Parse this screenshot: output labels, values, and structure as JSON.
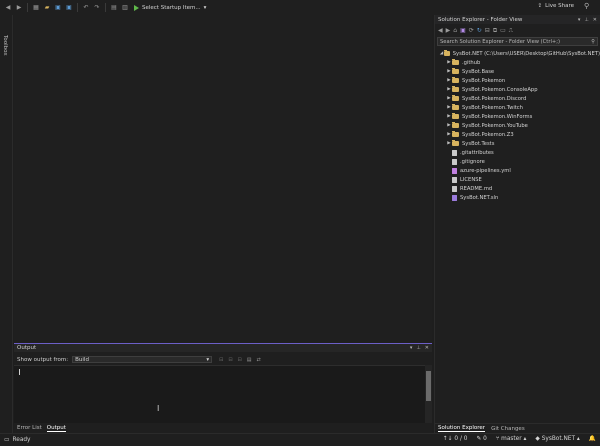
{
  "toolbar": {
    "startup_label": "Select Startup Item...",
    "liveshare_label": "Live Share"
  },
  "toolbox": {
    "label": "Toolbox"
  },
  "output": {
    "title": "Output",
    "show_from_label": "Show output from:",
    "source_value": "Build"
  },
  "bottom_tabs": [
    "Error List",
    "Output"
  ],
  "solution_explorer": {
    "title": "Solution Explorer - Folder View",
    "search_placeholder": "Search Solution Explorer - Folder View (Ctrl+;)",
    "root": "SysBot.NET (C:\\Users\\USER\\Desktop\\GitHub\\SysBot.NET)",
    "folders": [
      ".github",
      "SysBot.Base",
      "SysBot.Pokemon",
      "SysBot.Pokemon.ConsoleApp",
      "SysBot.Pokemon.Discord",
      "SysBot.Pokemon.Twitch",
      "SysBot.Pokemon.WinForms",
      "SysBot.Pokemon.YouTube",
      "SysBot.Pokemon.Z3",
      "SysBot.Tests"
    ],
    "files": [
      ".gitattributes",
      ".gitignore",
      "azure-pipelines.yml",
      "LICENSE",
      "README.md",
      "SysBot.NET.sln"
    ],
    "bottom_tabs": [
      "Solution Explorer",
      "Git Changes"
    ]
  },
  "status": {
    "ready": "Ready",
    "sync": "0 / 0",
    "changes": "0",
    "branch": "master",
    "repo": "SysBot.NET"
  }
}
